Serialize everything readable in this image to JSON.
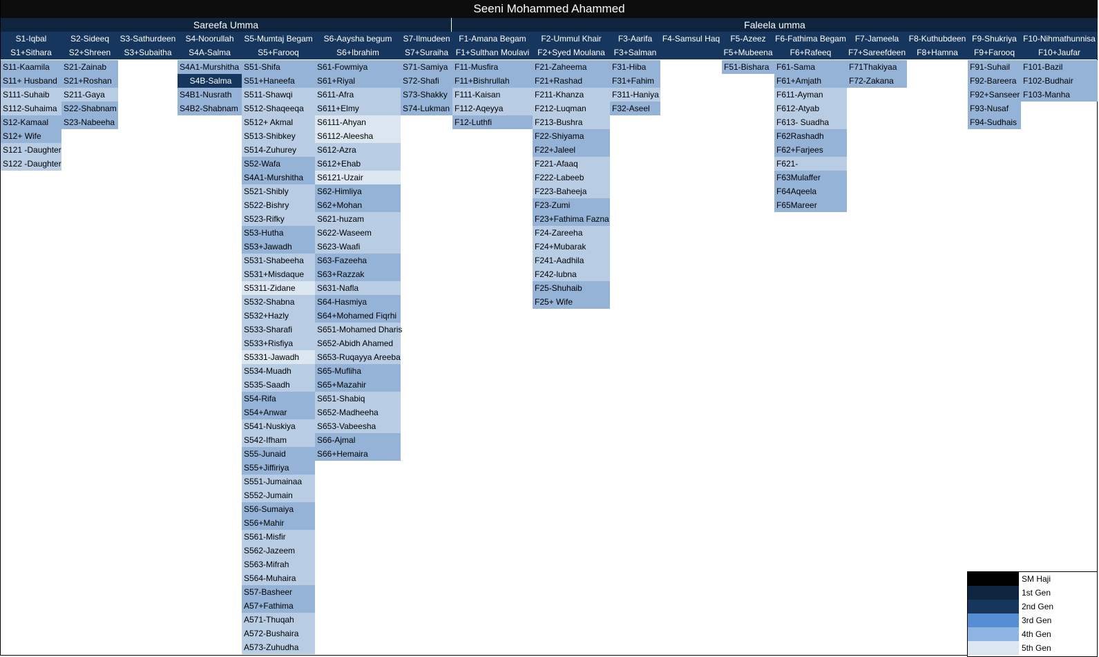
{
  "title": "Seeni Mohammed Ahammed",
  "gen1": [
    "Sareefa Umma",
    "Faleela umma"
  ],
  "header_row1": [
    "S1-Iqbal",
    "S2-Sideeq",
    "S3-Sathurdeen",
    "S4-Noorullah",
    "S5-Mumtaj Begam",
    "S6-Aaysha begum",
    "S7-Ilmudeen",
    "F1-Amana Begam",
    "F2-Ummul Khair",
    "F3-Aarifa",
    "F4-Samsul Haq",
    "F5-Azeez",
    "F6-Fathima Begam",
    "F7-Jameela",
    "F8-Kuthubdeen",
    "F9-Shukriya",
    "F10-Nihmathunnisa"
  ],
  "header_row2": [
    "S1+Sithara",
    "S2+Shreen",
    "S3+Subaitha",
    "S4A-Salma",
    "S5+Farooq",
    "S6+Ibrahim",
    "S7+Suraiha",
    "F1+Sulthan Moulavi",
    "F2+Syed Moulana",
    "F3+Salman",
    "",
    "F5+Mubeena",
    "F6+Rafeeq",
    "F7+Sareefdeen",
    "F8+Hamna",
    "F9+Farooq",
    "F10+Jaufar"
  ],
  "columns": [
    [
      "S11-Kaamila",
      "S11+ Husband",
      "S111-Suhaib",
      "S112-Suhaima",
      "S12-Kamaal",
      "S12+ Wife",
      "S121 -Daughter",
      "S122 -Daughter"
    ],
    [
      "S21-Zainab",
      "S21+Roshan",
      "S211-Gaya",
      "S22-Shabnam",
      "S23-Nabeeha"
    ],
    [],
    [
      "S4A1-Murshitha",
      "S4B-Salma",
      "S4B1-Nusrath",
      "S4B2-Shabnam"
    ],
    [
      "S51-Shifa",
      "S51+Haneefa",
      "S511-Shawqi",
      "S512-Shaqeeqa",
      "S512+ Akmal",
      "S513-Shibkey",
      "S514-Zuhurey",
      "S52-Wafa",
      "S4A1-Murshitha",
      "S521-Shibly",
      "S522-Bishry",
      "S523-Rifky",
      "S53-Hutha",
      "S53+Jawadh",
      "S531-Shabeeha",
      "S531+Misdaque",
      "S5311-Zidane",
      "S532-Shabna",
      "S532+Hazly",
      "S533-Sharafi",
      "S533+Risfiya",
      "S5331-Jawadh",
      "S534-Muadh",
      "S535-Saadh",
      "S54-Rifa",
      "S54+Anwar",
      "S541-Nuskiya",
      "S542-Ifham",
      "S55-Junaid",
      "S55+Jiffiriya",
      "S551-Jumainaa",
      "S552-Jumain",
      "S56-Sumaiya",
      "S56+Mahir",
      "S561-Misfir",
      "S562-Jazeem",
      "S563-Mifrah",
      "S564-Muhaira",
      "S57-Basheer",
      "A57+Fathima",
      "A571-Thuqah",
      "A572-Bushaira",
      "A573-Zuhudha"
    ],
    [
      "S61-Fowmiya",
      "S61+Riyal",
      "S611-Afra",
      "S611+Elmy",
      "S6111-Ahyan",
      "S6112-Aleesha",
      "S612-Azra",
      "S612+Ehab",
      "S6121-Uzair",
      "S62-Himliya",
      "S62+Mohan",
      "S621-huzam",
      "S622-Waseem",
      "S623-Waafi",
      "S63-Fazeeha",
      "S63+Razzak",
      "S631-Nafla",
      "S64-Hasmiya",
      "S64+Mohamed Fiqrhi",
      "S651-Mohamed Dharis",
      "S652-Abidh Ahamed",
      "S653-Ruqayya Areeba",
      "S65-Mufliha",
      "S65+Mazahir",
      "S651-Shabiq",
      "S652-Madheeha",
      "S653-Vabeesha",
      "S66-Ajmal",
      "S66+Hemaira"
    ],
    [
      "S71-Samiya",
      "S72-Shafi",
      "S73-Shakky",
      "S74-Lukman"
    ],
    [
      "F11-Musfira",
      "F11+Bishrullah",
      "F111-Kaisan",
      "F112-Aqeyya",
      "F12-Luthfi"
    ],
    [
      "F21-Zaheema",
      "F21+Rashad",
      "F211-Khanza",
      "F212-Luqman",
      "F213-Bushra",
      "F22-Shiyama",
      "F22+Jaleel",
      "F221-Afaaq",
      "F222-Labeeb",
      "F223-Baheeja",
      "F23-Zumi",
      "F23+Fathima Fazna",
      "F24-Zareeha",
      "F24+Mubarak",
      "F241-Aadhila",
      "F242-lubna",
      "F25-Shuhaib",
      "F25+ Wife"
    ],
    [
      "F31-Hiba",
      "F31+Fahim",
      "F311-Haniya",
      "F32-Aseel"
    ],
    [],
    [
      "F51-Bishara"
    ],
    [
      "F61-Sama",
      "F61+Amjath",
      "F611-Ayman",
      "F612-Atyab",
      "F613- Suadha",
      "F62Rashadh",
      "F62+Farjees",
      "F621-",
      "F63Mulaffer",
      "F64Aqeela",
      "F65Mareer"
    ],
    [
      "F71Thakiyaa",
      "F72-Zakana"
    ],
    [],
    [
      "F91-Suhail",
      "F92-Bareera",
      "F92+Sanseer",
      "F93-Nusaf",
      "F94-Sudhais"
    ],
    [
      "F101-Bazil",
      "F102-Budhair",
      "F103-Manha"
    ]
  ],
  "legend": [
    {
      "label": "SM Haji",
      "color": "#000000"
    },
    {
      "label": "1st Gen",
      "color": "#0f243e"
    },
    {
      "label": "2nd Gen",
      "color": "#17365d"
    },
    {
      "label": "3rd Gen",
      "color": "#558ed5"
    },
    {
      "label": "4th Gen",
      "color": "#8db4e2"
    },
    {
      "label": "5th Gen",
      "color": "#dce6f1"
    }
  ]
}
